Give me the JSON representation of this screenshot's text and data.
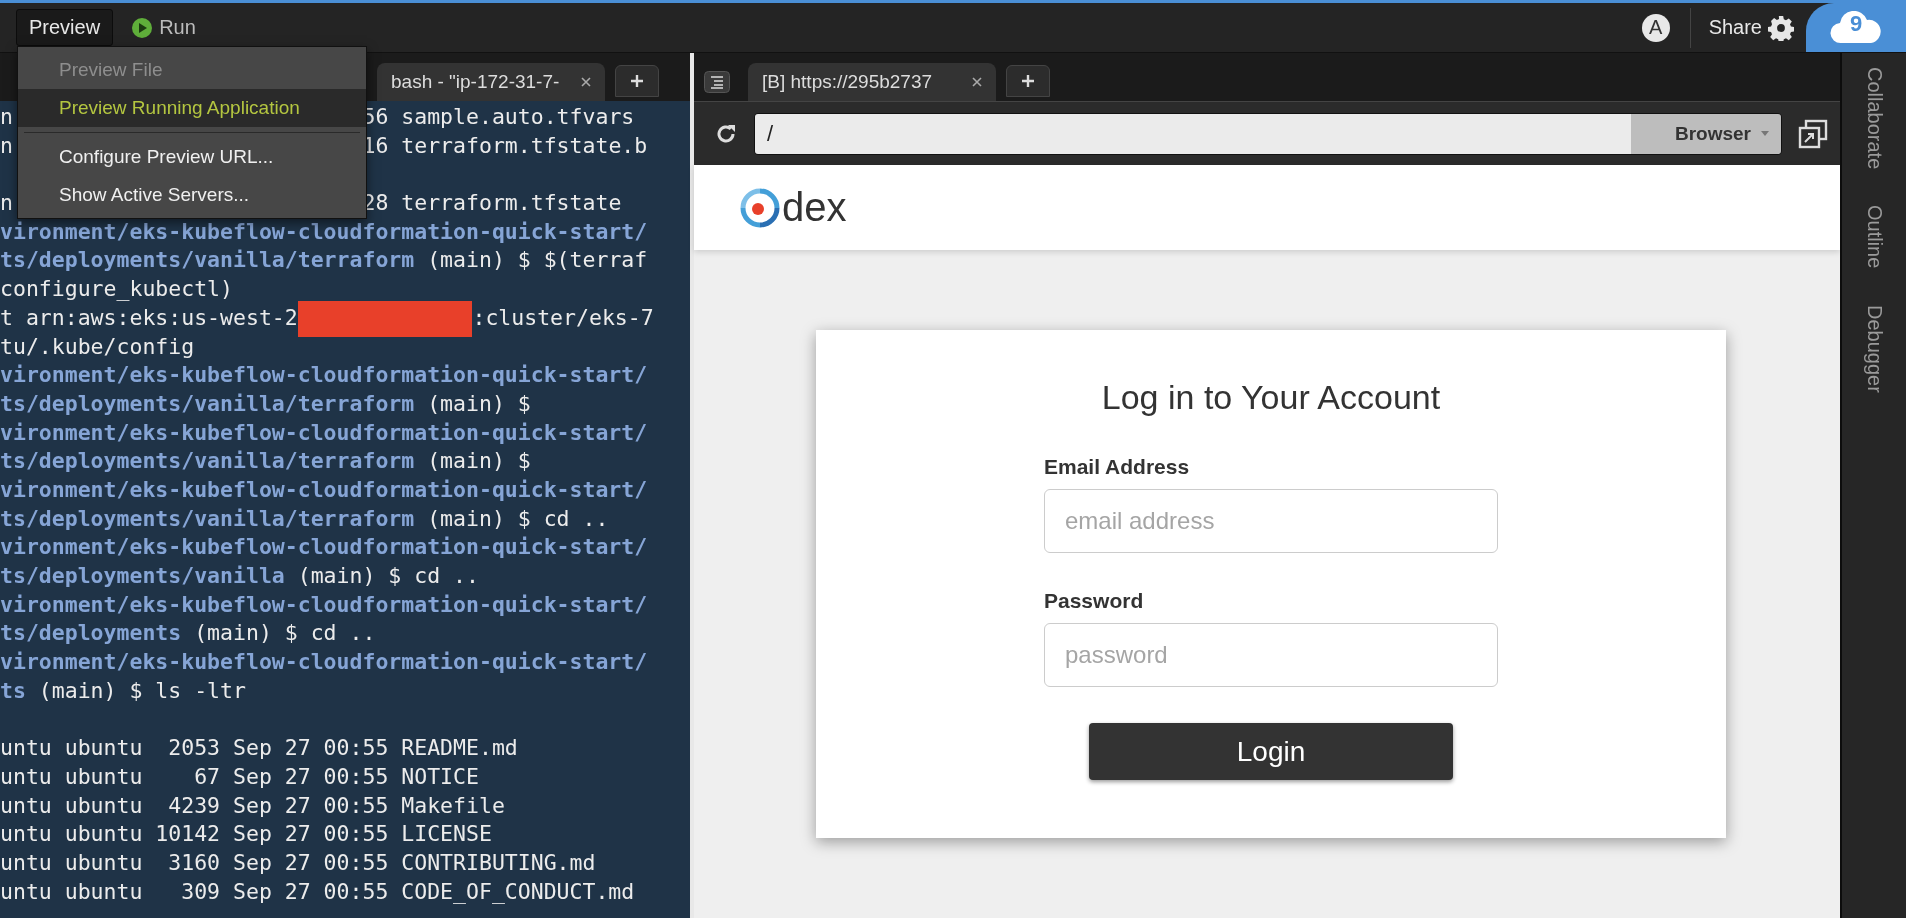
{
  "topbar": {
    "preview": {
      "label": "Preview"
    },
    "run": {
      "label": "Run"
    },
    "avatar": "A",
    "share": "Share",
    "logo": "9"
  },
  "preview_menu": {
    "open": true,
    "items": [
      {
        "kind": "item",
        "label": "Preview File",
        "disabled": true,
        "selected": false
      },
      {
        "kind": "item",
        "label": "Preview Running Application",
        "disabled": false,
        "selected": true
      },
      {
        "kind": "separator"
      },
      {
        "kind": "item",
        "label": "Configure Preview URL...",
        "disabled": false,
        "selected": false
      },
      {
        "kind": "item",
        "label": "Show Active Servers...",
        "disabled": false,
        "selected": false
      }
    ]
  },
  "terminal": {
    "tabs": [
      {
        "label": "bash - \"ip-172-31-7-",
        "selected": true
      }
    ],
    "lines": [
      {
        "kind": "output",
        "segments": [
          {
            "kind": "plain",
            "text": "n"
          },
          {
            "kind": "covered"
          },
          {
            "kind": "plain",
            "text": "56 sample.auto.tfvars"
          }
        ]
      },
      {
        "kind": "output",
        "segments": [
          {
            "kind": "plain",
            "text": "n"
          },
          {
            "kind": "covered"
          },
          {
            "kind": "plain",
            "text": "16 terraform.tfstate.b"
          }
        ]
      },
      {
        "kind": "blank"
      },
      {
        "kind": "output",
        "segments": [
          {
            "kind": "plain",
            "text": "n"
          },
          {
            "kind": "covered"
          },
          {
            "kind": "plain",
            "text": "28 terraform.tfstate"
          }
        ]
      },
      {
        "kind": "output",
        "segments": [
          {
            "kind": "path",
            "text": "vironment/eks-kubeflow-cloudformation-quick-start/"
          }
        ]
      },
      {
        "kind": "output",
        "segments": [
          {
            "kind": "path",
            "text": "ts/deployments/vanilla/terraform"
          },
          {
            "kind": "plain",
            "text": " (main) $ $(terraf"
          }
        ]
      },
      {
        "kind": "output",
        "segments": [
          {
            "kind": "plain",
            "text": "configure_kubectl)"
          }
        ]
      },
      {
        "kind": "output",
        "segments": [
          {
            "kind": "plain",
            "text": "t arn:aws:eks:us-west-2"
          },
          {
            "kind": "redacted"
          },
          {
            "kind": "plain",
            "text": ":cluster/eks-7"
          }
        ]
      },
      {
        "kind": "output",
        "segments": [
          {
            "kind": "plain",
            "text": "tu/.kube/config"
          }
        ]
      },
      {
        "kind": "output",
        "segments": [
          {
            "kind": "path",
            "text": "vironment/eks-kubeflow-cloudformation-quick-start/"
          }
        ]
      },
      {
        "kind": "output",
        "segments": [
          {
            "kind": "path",
            "text": "ts/deployments/vanilla/terraform"
          },
          {
            "kind": "plain",
            "text": " (main) $"
          }
        ]
      },
      {
        "kind": "output",
        "segments": [
          {
            "kind": "path",
            "text": "vironment/eks-kubeflow-cloudformation-quick-start/"
          }
        ]
      },
      {
        "kind": "output",
        "segments": [
          {
            "kind": "path",
            "text": "ts/deployments/vanilla/terraform"
          },
          {
            "kind": "plain",
            "text": " (main) $"
          }
        ]
      },
      {
        "kind": "output",
        "segments": [
          {
            "kind": "path",
            "text": "vironment/eks-kubeflow-cloudformation-quick-start/"
          }
        ]
      },
      {
        "kind": "output",
        "segments": [
          {
            "kind": "path",
            "text": "ts/deployments/vanilla/terraform"
          },
          {
            "kind": "plain",
            "text": " (main) $ cd .."
          }
        ]
      },
      {
        "kind": "output",
        "segments": [
          {
            "kind": "path",
            "text": "vironment/eks-kubeflow-cloudformation-quick-start/"
          }
        ]
      },
      {
        "kind": "output",
        "segments": [
          {
            "kind": "path",
            "text": "ts/deployments/vanilla"
          },
          {
            "kind": "plain",
            "text": " (main) $ cd .."
          }
        ]
      },
      {
        "kind": "output",
        "segments": [
          {
            "kind": "path",
            "text": "vironment/eks-kubeflow-cloudformation-quick-start/"
          }
        ]
      },
      {
        "kind": "output",
        "segments": [
          {
            "kind": "path",
            "text": "ts/deployments"
          },
          {
            "kind": "plain",
            "text": " (main) $ cd .."
          }
        ]
      },
      {
        "kind": "output",
        "segments": [
          {
            "kind": "path",
            "text": "vironment/eks-kubeflow-cloudformation-quick-start/"
          }
        ]
      },
      {
        "kind": "output",
        "segments": [
          {
            "kind": "path",
            "text": "ts"
          },
          {
            "kind": "plain",
            "text": " (main) $ ls -ltr"
          }
        ]
      },
      {
        "kind": "blank"
      },
      {
        "kind": "output",
        "segments": [
          {
            "kind": "plain",
            "text": "untu ubuntu  2053 Sep 27 00:55 README.md"
          }
        ]
      },
      {
        "kind": "output",
        "segments": [
          {
            "kind": "plain",
            "text": "untu ubuntu    67 Sep 27 00:55 NOTICE"
          }
        ]
      },
      {
        "kind": "output",
        "segments": [
          {
            "kind": "plain",
            "text": "untu ubuntu  4239 Sep 27 00:55 Makefile"
          }
        ]
      },
      {
        "kind": "output",
        "segments": [
          {
            "kind": "plain",
            "text": "untu ubuntu 10142 Sep 27 00:55 LICENSE"
          }
        ]
      },
      {
        "kind": "output",
        "segments": [
          {
            "kind": "plain",
            "text": "untu ubuntu  3160 Sep 27 00:55 CONTRIBUTING.md"
          }
        ]
      },
      {
        "kind": "output",
        "segments": [
          {
            "kind": "plain",
            "text": "untu ubuntu   309 Sep 27 00:55 CODE_OF_CONDUCT.md"
          }
        ]
      }
    ]
  },
  "browser": {
    "tabs": [
      {
        "label": "[B] https://295b2737",
        "selected": true
      }
    ],
    "address": "/",
    "mode": "Browser",
    "page": {
      "brand": "dex",
      "title": "Log in to Your Account",
      "fields": [
        {
          "label": "Email Address",
          "placeholder": "email address"
        },
        {
          "label": "Password",
          "placeholder": "password"
        }
      ],
      "submit": "Login"
    }
  },
  "sidebar": {
    "items": [
      {
        "label": "Collaborate"
      },
      {
        "label": "Outline"
      },
      {
        "label": "Debugger"
      }
    ]
  }
}
